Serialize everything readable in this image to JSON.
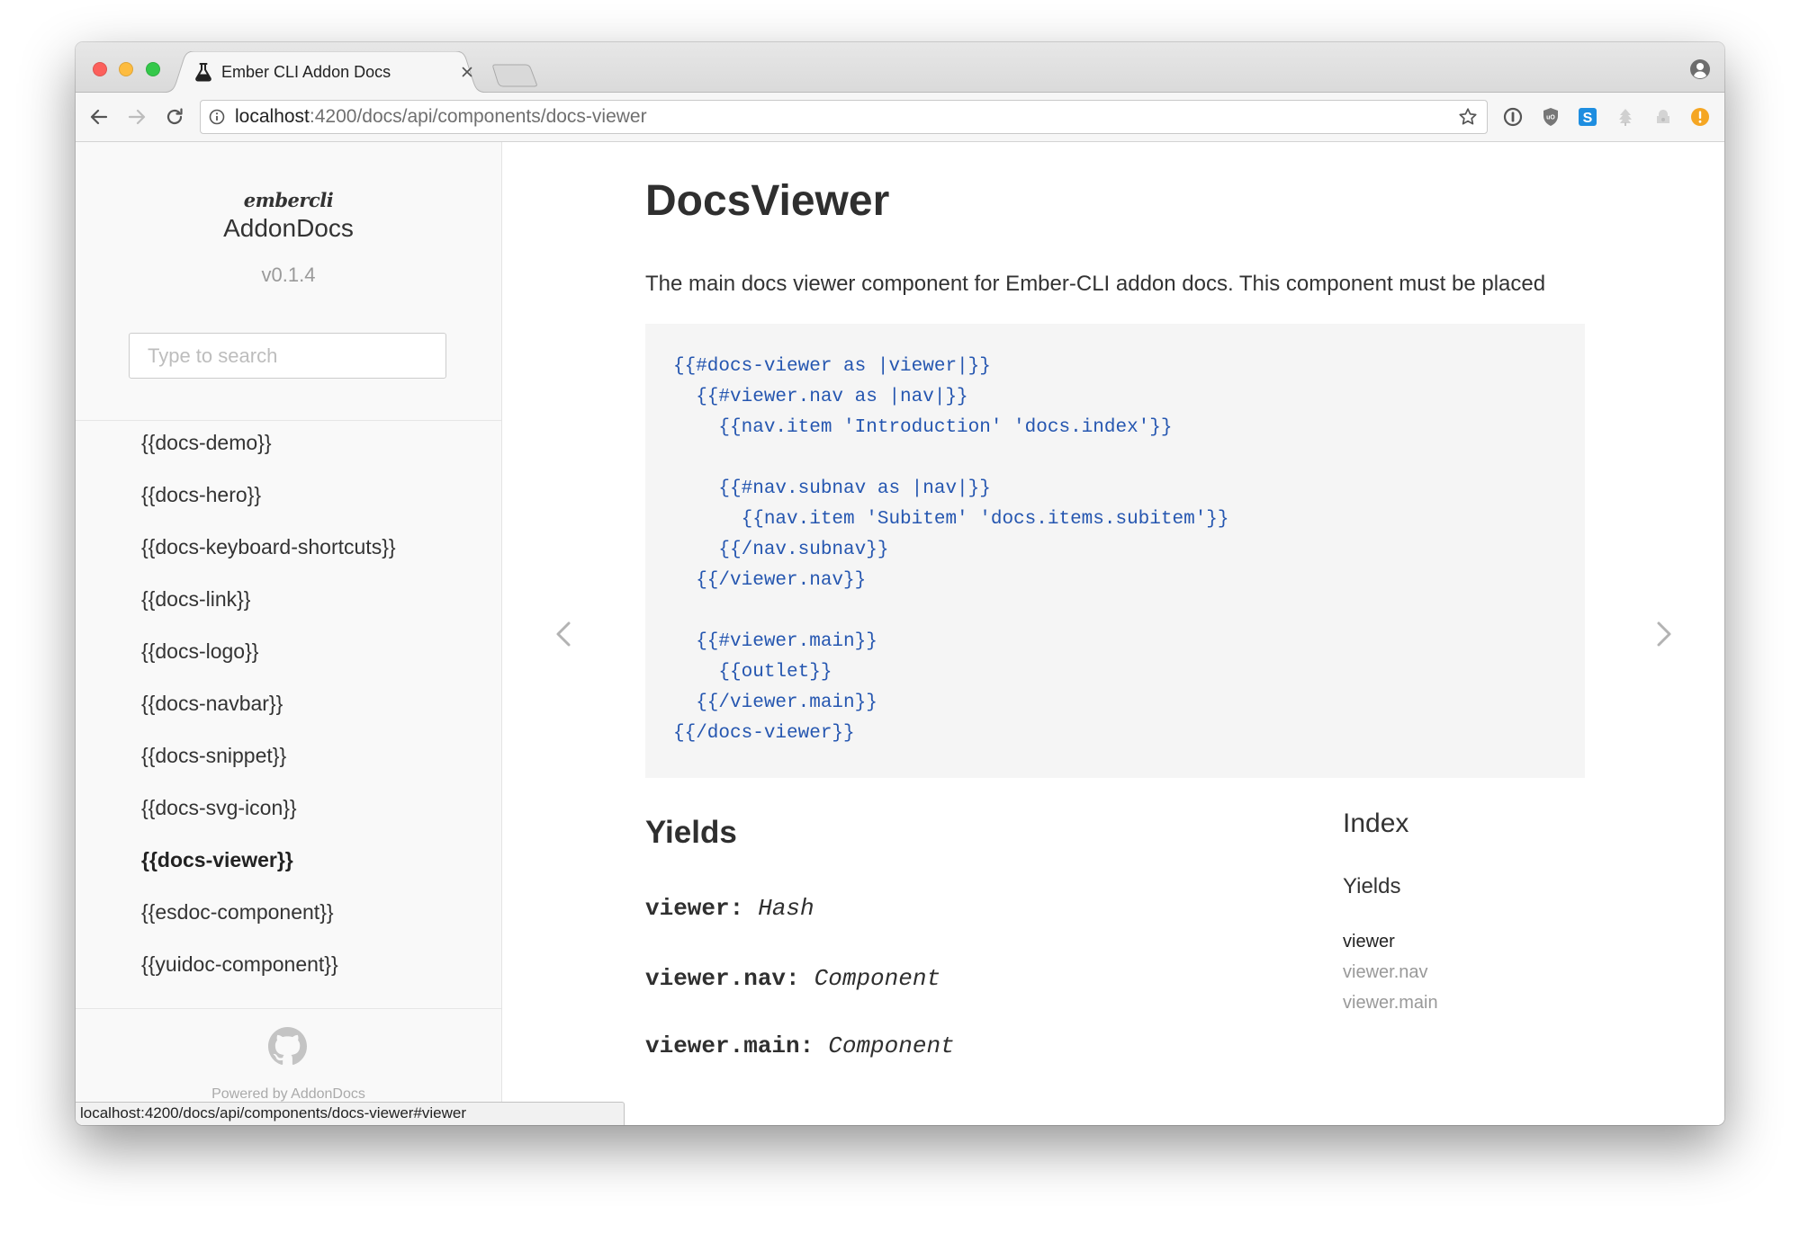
{
  "window": {
    "tab_title": "Ember CLI Addon Docs",
    "url": {
      "host": "localhost",
      "path": ":4200/docs/api/components/docs-viewer"
    },
    "status_url": "localhost:4200/docs/api/components/docs-viewer#viewer",
    "favicon": "flask-icon",
    "nav_icons": [
      "back-arrow-icon",
      "forward-arrow-icon",
      "reload-icon",
      "info-icon",
      "bookmark-star-icon",
      "profile-icon"
    ],
    "extensions": [
      {
        "icon": "onepassword-icon"
      },
      {
        "icon": "ublock-icon",
        "letters": "uO"
      },
      {
        "icon": "skype-icon",
        "letters": "S"
      },
      {
        "icon": "disabled-extension-icon"
      },
      {
        "icon": "disabled-extension-icon"
      },
      {
        "icon": "alert-icon"
      }
    ]
  },
  "colors": {
    "close": "#fc605c",
    "minimize": "#fdbc40",
    "zoom": "#34c84a",
    "code": "#2556b0",
    "text": "#333333",
    "muted": "#999999",
    "alert": "#f5a623",
    "skype": "#1e8ee0"
  },
  "sidebar": {
    "logo_top": "embercli",
    "logo_bottom": "AddonDocs",
    "version": "v0.1.4",
    "search_placeholder": "Type to search",
    "items": [
      {
        "label": "{{docs-demo}}"
      },
      {
        "label": "{{docs-hero}}"
      },
      {
        "label": "{{docs-keyboard-shortcuts}}"
      },
      {
        "label": "{{docs-link}}"
      },
      {
        "label": "{{docs-logo}}"
      },
      {
        "label": "{{docs-navbar}}"
      },
      {
        "label": "{{docs-snippet}}"
      },
      {
        "label": "{{docs-svg-icon}}"
      },
      {
        "label": "{{docs-viewer}}",
        "active": true
      },
      {
        "label": "{{esdoc-component}}"
      },
      {
        "label": "{{yuidoc-component}}"
      }
    ],
    "footer_icon": "github-icon",
    "footer": "Powered by AddonDocs"
  },
  "main": {
    "title": "DocsViewer",
    "description": "The main docs viewer component for Ember-CLI addon docs. This component must be placed",
    "code_lines": [
      "{{#docs-viewer as |viewer|}}",
      "  {{#viewer.nav as |nav|}}",
      "    {{nav.item 'Introduction' 'docs.index'}}",
      "",
      "    {{#nav.subnav as |nav|}}",
      "      {{nav.item 'Subitem' 'docs.items.subitem'}}",
      "    {{/nav.subnav}}",
      "  {{/viewer.nav}}",
      "",
      "  {{#viewer.main}}",
      "    {{outlet}}",
      "  {{/viewer.main}}",
      "{{/docs-viewer}}"
    ],
    "yields_heading": "Yields",
    "yields": [
      {
        "label": "viewer:",
        "type": "Hash"
      },
      {
        "label": "viewer.nav:",
        "type": "Component"
      },
      {
        "label": "viewer.main:",
        "type": "Component"
      }
    ]
  },
  "index": {
    "heading": "Index",
    "section": "Yields",
    "items": [
      {
        "label": "viewer",
        "active": true
      },
      {
        "label": "viewer.nav"
      },
      {
        "label": "viewer.main"
      }
    ]
  }
}
